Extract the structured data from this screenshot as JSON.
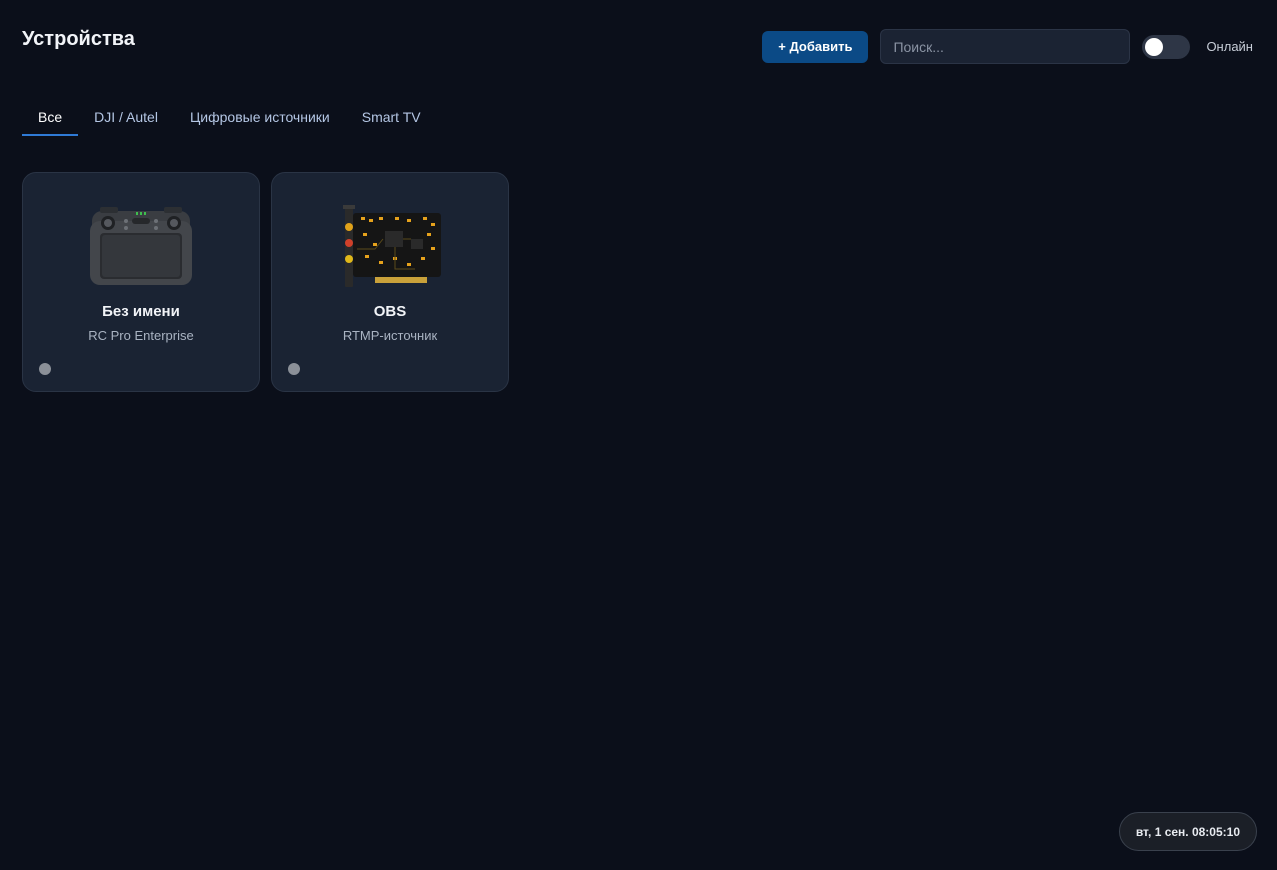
{
  "header": {
    "title": "Устройства"
  },
  "toolbar": {
    "add_label": "+ Добавить",
    "search_placeholder": "Поиск...",
    "online_label": "Онлайн",
    "online_toggle_on": false
  },
  "tabs": [
    {
      "label": "Все",
      "active": true
    },
    {
      "label": "DJI / Autel",
      "active": false
    },
    {
      "label": "Цифровые источники",
      "active": false
    },
    {
      "label": "Smart TV",
      "active": false
    }
  ],
  "devices": [
    {
      "name": "Без имени",
      "model": "RC Pro Enterprise",
      "icon": "remote-controller-icon",
      "status": "offline"
    },
    {
      "name": "OBS",
      "model": "RTMP-источник",
      "icon": "capture-card-icon",
      "status": "offline"
    }
  ],
  "clock": {
    "text": "вт, 1 сен. 08:05:10"
  },
  "colors": {
    "background": "#0b0f1a",
    "accent": "#0b4a86",
    "tab_underline": "#2f7ad6",
    "card_bg": "#1a2333",
    "status_offline": "#8b9098"
  }
}
